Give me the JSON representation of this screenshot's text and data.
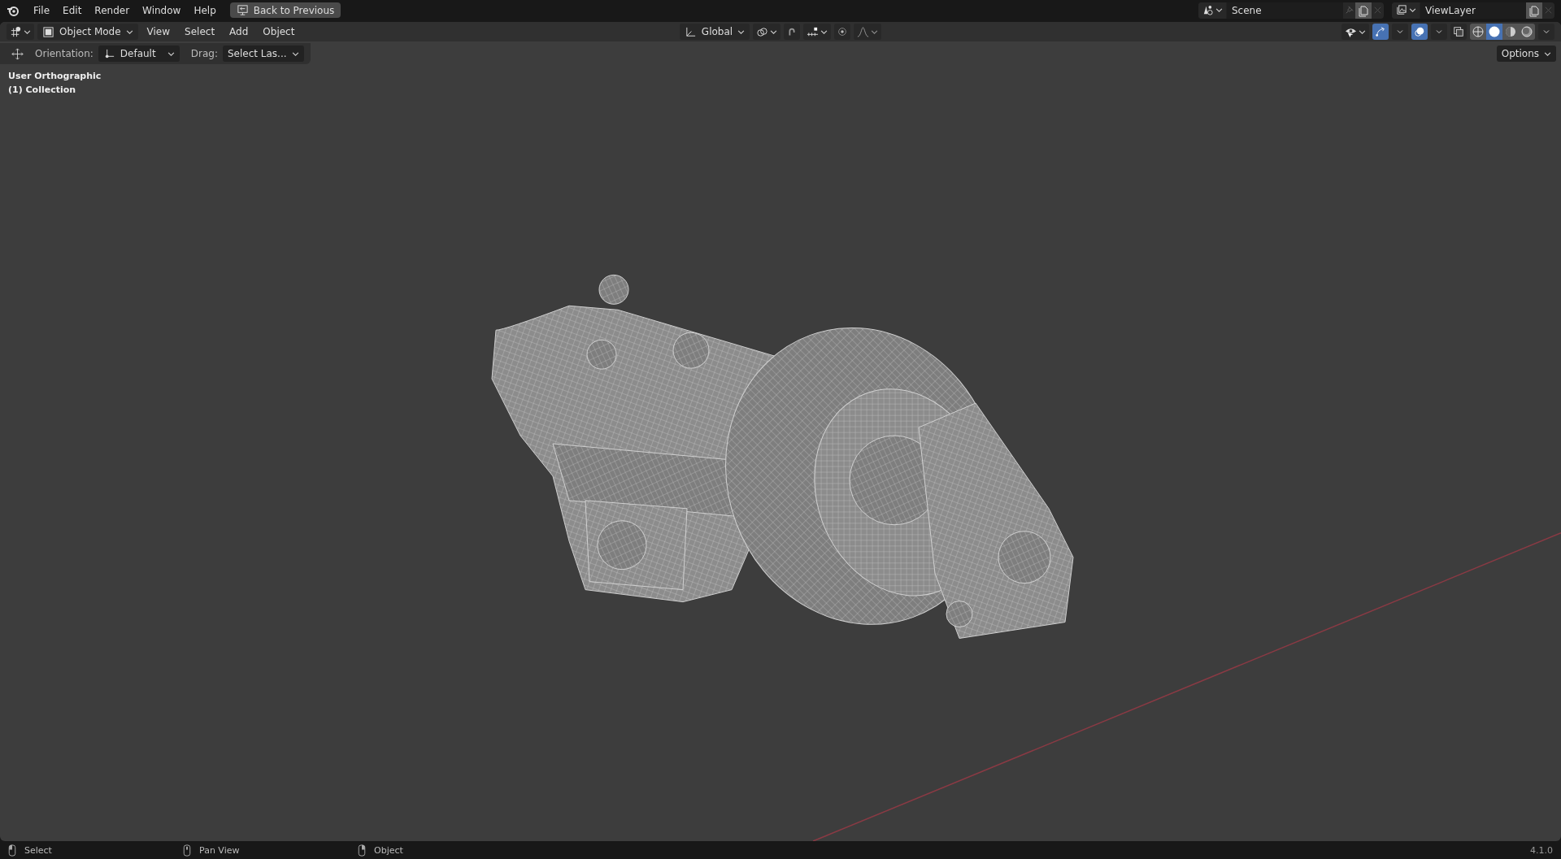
{
  "top_bar": {
    "menus": [
      "File",
      "Edit",
      "Render",
      "Window",
      "Help"
    ],
    "back_button": "Back to Previous",
    "scene": {
      "value": "Scene"
    },
    "view_layer": {
      "value": "ViewLayer"
    }
  },
  "header": {
    "mode": "Object Mode",
    "menus": [
      "View",
      "Select",
      "Add",
      "Object"
    ],
    "orientation": "Global",
    "gizmos_on": true,
    "overlays_on": true,
    "shading": [
      {
        "kind": "wireframe",
        "selected": false
      },
      {
        "kind": "solid",
        "selected": true
      },
      {
        "kind": "material",
        "selected": false
      },
      {
        "kind": "rendered",
        "selected": false
      }
    ]
  },
  "tool_settings": {
    "orientation_label": "Orientation:",
    "orientation": "Default",
    "drag_label": "Drag:",
    "drag": "Select Las...",
    "options": "Options"
  },
  "viewport": {
    "view_name": "User Orthographic",
    "collection": "(1) Collection"
  },
  "status_bar": {
    "items": [
      {
        "kind": "left",
        "label": "Select"
      },
      {
        "kind": "middle",
        "label": "Pan View"
      },
      {
        "kind": "right",
        "label": "Object"
      }
    ],
    "version": "4.1.0"
  }
}
